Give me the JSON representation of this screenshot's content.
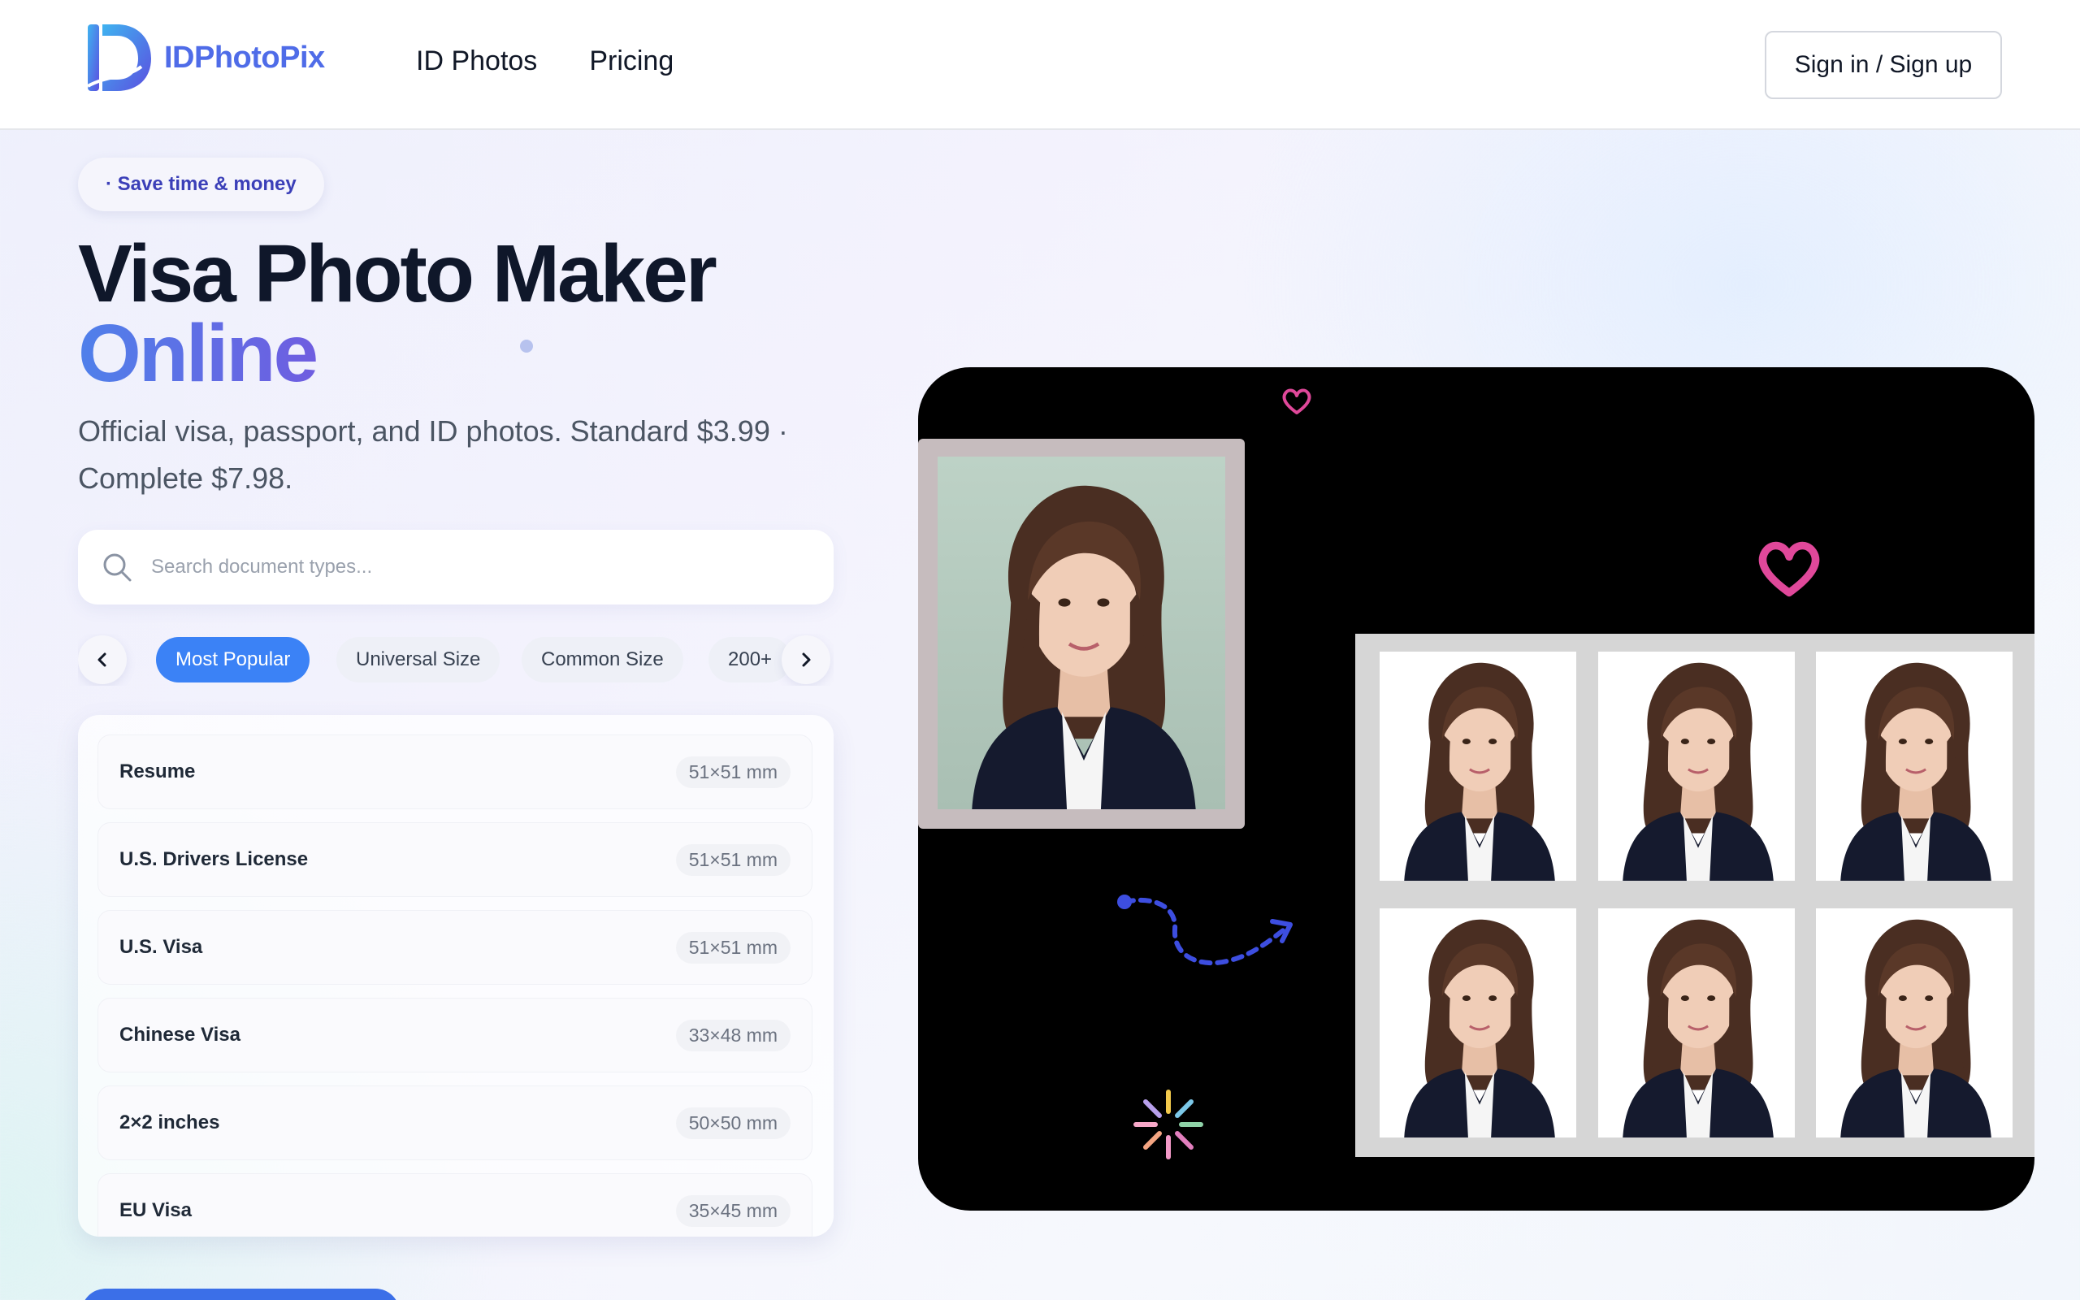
{
  "brand": {
    "name": "IDPhotoPix",
    "accent": "#4f6ce8"
  },
  "nav": {
    "items": [
      {
        "label": "ID Photos"
      },
      {
        "label": "Pricing"
      }
    ]
  },
  "header": {
    "signin_label": "Sign in / Sign up"
  },
  "hero": {
    "badge": "· Save time & money",
    "title_line1": "Visa Photo Maker",
    "title_line2": "Online",
    "subtitle": "Official visa, passport, and ID photos. Standard $3.99 · Complete $7.98."
  },
  "search": {
    "placeholder": "Search document types...",
    "value": ""
  },
  "tabs": {
    "items": [
      {
        "label": "Most Popular",
        "active": true
      },
      {
        "label": "Universal Size",
        "active": false
      },
      {
        "label": "Common Size",
        "active": false
      },
      {
        "label": "200+",
        "active": false
      }
    ]
  },
  "documents": [
    {
      "name": "Resume",
      "size": "51×51 mm"
    },
    {
      "name": "U.S. Drivers License",
      "size": "51×51 mm"
    },
    {
      "name": "U.S. Visa",
      "size": "51×51 mm"
    },
    {
      "name": "Chinese Visa",
      "size": "33×48 mm"
    },
    {
      "name": "2×2 inches",
      "size": "50×50 mm"
    },
    {
      "name": "EU Visa",
      "size": "35×45 mm"
    }
  ],
  "colors": {
    "primary_blue": "#3b82f6",
    "heart_pink": "#e0489a",
    "arrow_blue": "#3d4ee0"
  },
  "icons": [
    "logo-mark-icon",
    "search-icon",
    "chevron-left-icon",
    "chevron-right-icon",
    "heart-icon",
    "dashed-arrow-icon",
    "sparkle-burst-icon"
  ]
}
